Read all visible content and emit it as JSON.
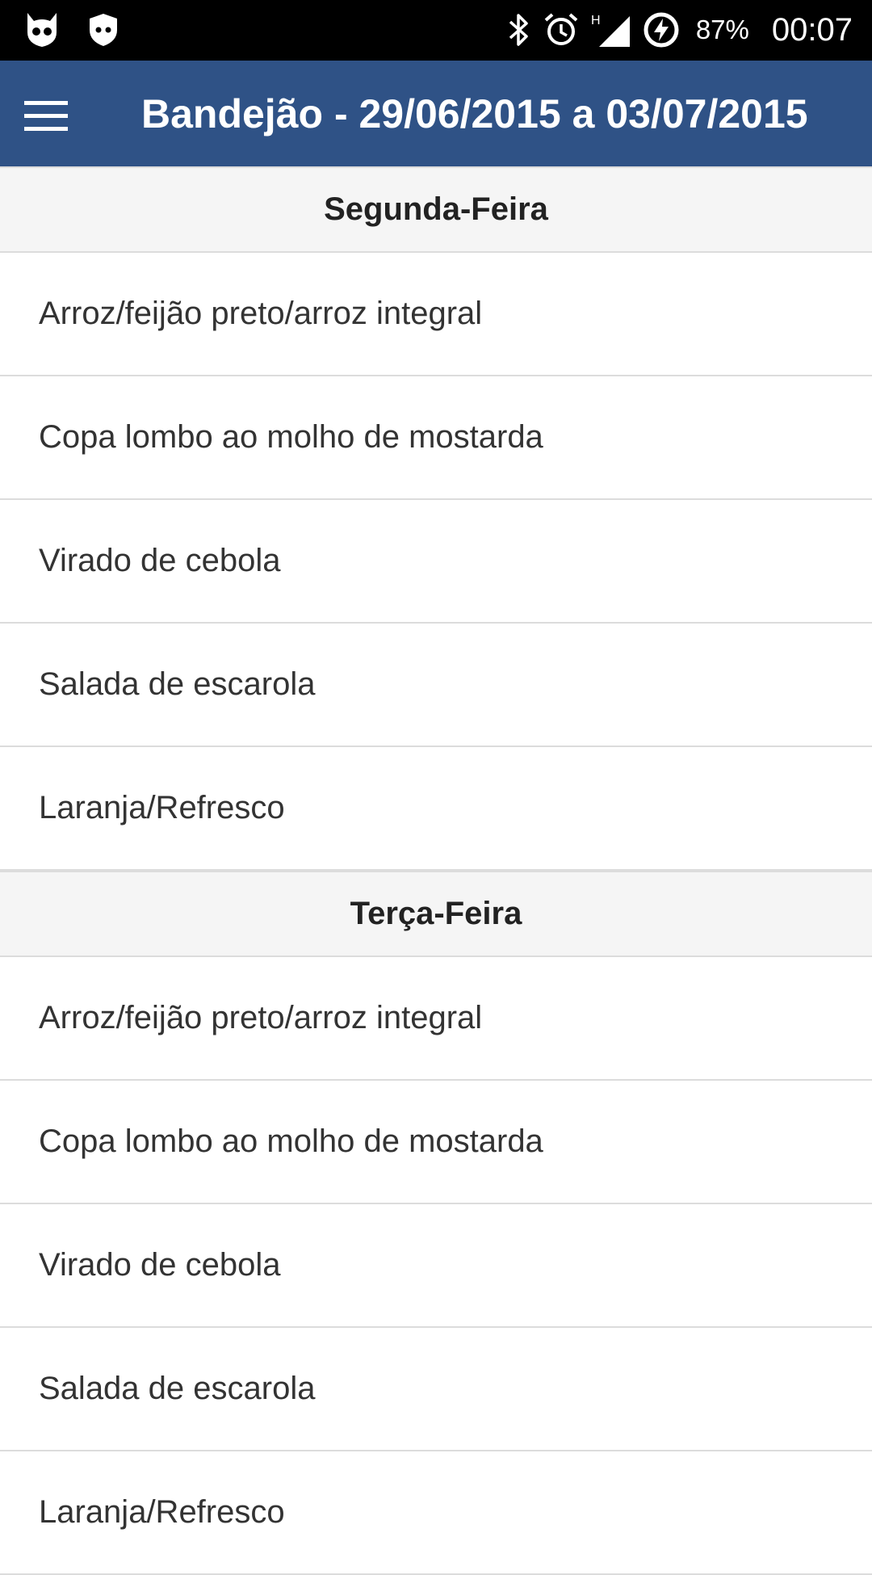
{
  "status_bar": {
    "icons_left": [
      "cyanogenmod-icon",
      "shield-icon"
    ],
    "icons_right": [
      "bluetooth-icon",
      "alarm-icon",
      "signal-h-icon",
      "battery-charging-icon"
    ],
    "network_type": "H",
    "battery": "87%",
    "time": "00:07"
  },
  "app_bar": {
    "title": "Bandejão - 29/06/2015 a 03/07/2015",
    "menu_icon": "hamburger-menu-icon",
    "background_color": "#2f5286"
  },
  "days": [
    {
      "name": "Segunda-Feira",
      "items": [
        "Arroz/feijão preto/arroz integral",
        "Copa lombo ao molho de mostarda",
        "Virado de cebola",
        "Salada de escarola",
        "Laranja/Refresco"
      ]
    },
    {
      "name": "Terça-Feira",
      "items": [
        "Arroz/feijão preto/arroz integral",
        "Copa lombo ao molho de mostarda",
        "Virado de cebola",
        "Salada de escarola",
        "Laranja/Refresco"
      ]
    }
  ]
}
